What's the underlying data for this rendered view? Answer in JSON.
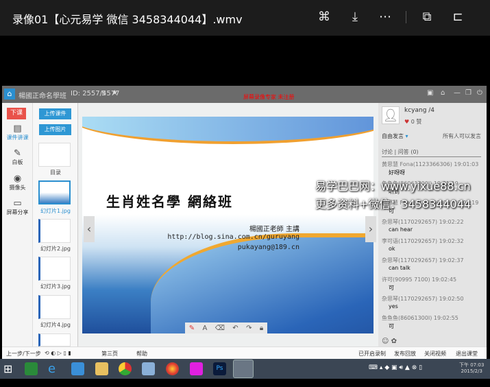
{
  "player": {
    "title": "录像01【心元易学 微信 3458344044】.wmv",
    "icons": [
      "share-icon",
      "download-icon",
      "more-icon",
      "cast-icon",
      "exit-icon"
    ]
  },
  "app": {
    "header": {
      "title": "楊國正命名學班",
      "room_id": "ID: 2557/4577",
      "users": "5",
      "recording_notice": "屏幕录像专家 未注册"
    },
    "sidebar": {
      "exit": "下课",
      "items": [
        "课件讲课",
        "白板",
        "摄像头",
        "屏幕分享"
      ]
    },
    "thumbs": {
      "upload1": "上传课件",
      "upload2": "上传图片",
      "items": [
        "目录",
        "幻灯片1.jpg",
        "幻灯片2.jpg",
        "幻灯片3.jpg",
        "幻灯片4.jpg"
      ]
    },
    "slide": {
      "title": "生肖姓名學 網絡班",
      "author": "楊國正老師 主講",
      "url": "http://blog.sina.com.cn/guruyang",
      "email": "pukayang@189.cn"
    },
    "right": {
      "username": "kcyang /4",
      "likes": "0 赞",
      "mode": "自由发言",
      "permission": "所有人可以发言",
      "tab": "讨论 | 问答 (0)",
      "messages": [
        {
          "from": "黄思慧 Fona(1123366306) 19:01:03",
          "text": "好呀呀"
        },
        {
          "from": "鱼鱼鱼(86061300I) 19:01:19",
          "text": "听到"
        },
        {
          "from": "黄思慧 Fona(1123366306) 19:01:19",
          "text": "可"
        },
        {
          "from": "杂思琴(1170292657) 19:02:22",
          "text": "can hear"
        },
        {
          "from": "李可语(1170292657) 19:02:32",
          "text": "ok"
        },
        {
          "from": "杂思琴(1170292657) 19:02:37",
          "text": "can talk"
        },
        {
          "from": "许可(90995 7100) 19:02:45",
          "text": "可"
        },
        {
          "from": "杂思琴(1170292657) 19:02:50",
          "text": "yes"
        },
        {
          "from": "鱼鱼鱼(86061300I) 19:02:55",
          "text": "可"
        }
      ]
    },
    "status": {
      "left": "上一步/下一步",
      "middle": "第三页",
      "help": "帮助",
      "right": [
        "已开启录制",
        "发布回放",
        "关闭视频",
        "退出课堂"
      ]
    }
  },
  "watermark": {
    "line1": "易学巴巴网：www.yixue88.cn",
    "line2": "更多资料+微信：3458344044"
  },
  "taskbar": {
    "time": "下午 07:03",
    "date": "2015/2/3"
  }
}
